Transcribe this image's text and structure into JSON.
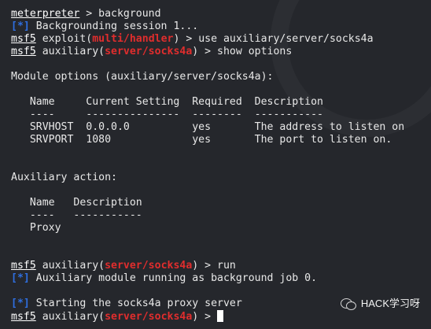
{
  "lines": {
    "l1": {
      "prompt": "meterpreter",
      "rest": " > background"
    },
    "l2": {
      "tag": "[*]",
      "text": " Backgrounding session 1..."
    },
    "l3": {
      "prompt": "msf5",
      "pre": " exploit(",
      "mod": "multi/handler",
      "post": ") > use auxiliary/server/socks4a"
    },
    "l4": {
      "prompt": "msf5",
      "pre": " auxiliary(",
      "mod": "server/socks4a",
      "post": ") > show options"
    },
    "l5": "Module options (auxiliary/server/socks4a):",
    "l6": "   Name     Current Setting  Required  Description",
    "l7": "   ----     ---------------  --------  -----------",
    "l8": "   SRVHOST  0.0.0.0          yes       The address to listen on",
    "l9": "   SRVPORT  1080             yes       The port to listen on.",
    "l10": "Auxiliary action:",
    "l11": "   Name   Description",
    "l12": "   ----   -----------",
    "l13": "   Proxy",
    "l14": {
      "prompt": "msf5",
      "pre": " auxiliary(",
      "mod": "server/socks4a",
      "post": ") > run"
    },
    "l15": {
      "tag": "[*]",
      "text": " Auxiliary module running as background job 0."
    },
    "l16": {
      "tag": "[*]",
      "text": " Starting the socks4a proxy server"
    },
    "l17": {
      "prompt": "msf5",
      "pre": " auxiliary(",
      "mod": "server/socks4a",
      "post": ") > "
    }
  },
  "watermark": {
    "icon": "wechat-icon",
    "text": "HACK学习呀"
  },
  "colors": {
    "background": "#25272c",
    "module": "#e02d2d",
    "status_tag": "#2f6fe0",
    "text": "#e8e8e8"
  }
}
